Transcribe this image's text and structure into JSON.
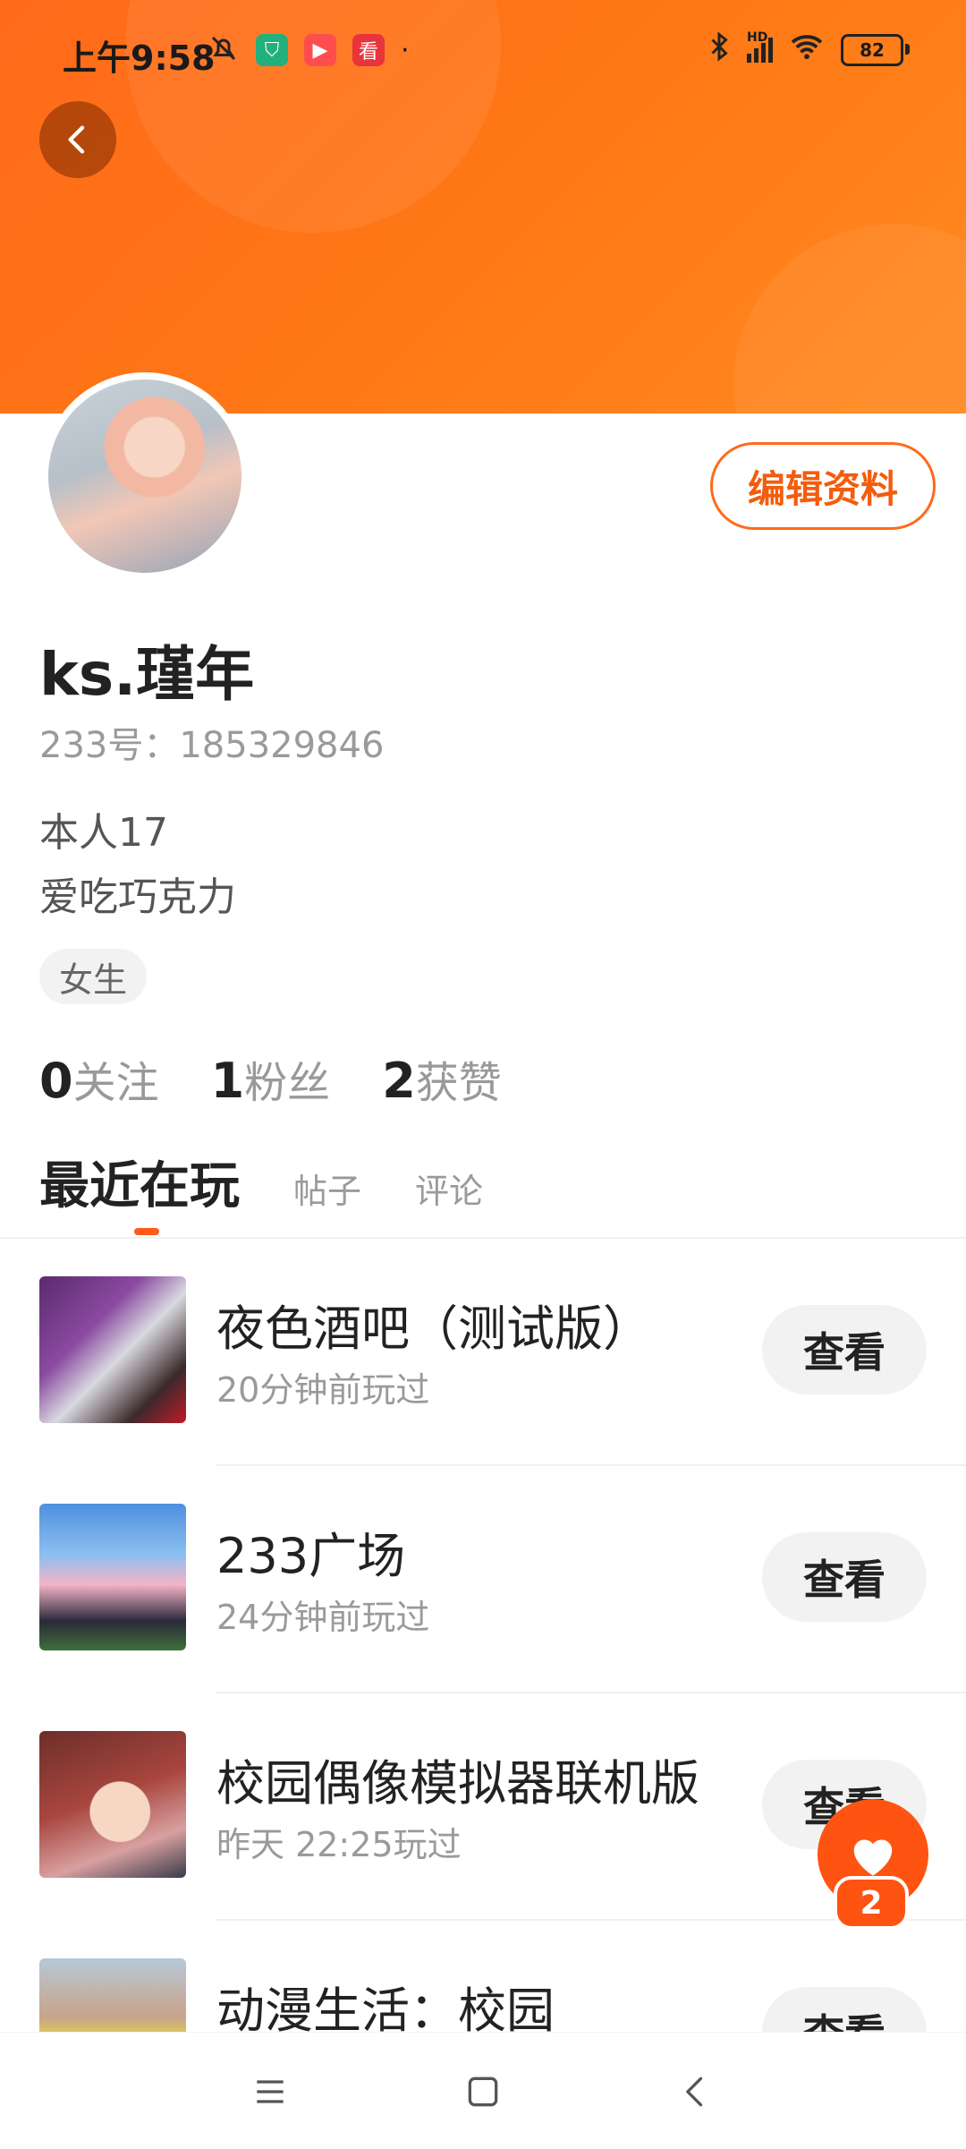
{
  "status_bar": {
    "time": "上午9:58",
    "battery": "82",
    "network": "HD"
  },
  "profile": {
    "edit_label": "编辑资料",
    "name": "ks.瑾年",
    "id_text": "233号：185329846",
    "bio_line1": "本人17",
    "bio_line2": "爱吃巧克力",
    "gender_tag": "女生"
  },
  "stats": {
    "following_count": "0",
    "following_label": "关注",
    "followers_count": "1",
    "followers_label": "粉丝",
    "likes_count": "2",
    "likes_label": "获赞"
  },
  "tabs": {
    "active": "最近在玩",
    "posts": "帖子",
    "comments": "评论"
  },
  "games": [
    {
      "title": "夜色酒吧（测试版）",
      "time": "20分钟前玩过",
      "button": "查看"
    },
    {
      "title": "233广场",
      "time": "24分钟前玩过",
      "button": "查看"
    },
    {
      "title": "校园偶像模拟器联机版",
      "time": "昨天 22:25玩过",
      "button": "查看"
    },
    {
      "title": "动漫生活：校园",
      "time": "",
      "button": "查看"
    }
  ],
  "fab": {
    "badge": "2",
    "icon": "heart-icon"
  },
  "colors": {
    "accent": "#ff6a1a",
    "accent_dark": "#f25d0e"
  }
}
